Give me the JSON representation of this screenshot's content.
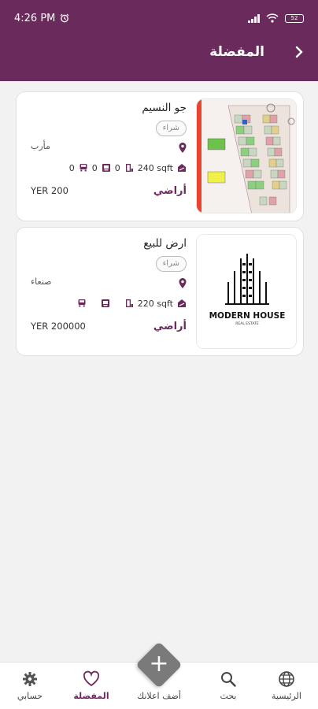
{
  "status_bar": {
    "time": "4:26 PM",
    "battery": "52"
  },
  "header": {
    "title": "المفضلة"
  },
  "listings": [
    {
      "title": "جو النسيم",
      "badge": "شراء",
      "city": "مأرب",
      "area": "240 sqft",
      "rooms": "0",
      "bathrooms": "0",
      "parking": "0",
      "price": "YER 200",
      "category": "أراضي"
    },
    {
      "title": "ارض للبيع",
      "badge": "شراء",
      "city": "صنعاء",
      "area": "220 sqft",
      "price": "YER 200000",
      "category": "أراضي",
      "logo_title": "MODERN HOUSE",
      "logo_subtitle": "REAL ESTATE"
    }
  ],
  "nav": {
    "home": "الرئيسية",
    "search": "بحث",
    "add": "أضف اعلانك",
    "favorites": "المفضلة",
    "account": "حسابي"
  },
  "colors": {
    "brand": "#6b2a5c",
    "fab": "#7a7a7a"
  }
}
